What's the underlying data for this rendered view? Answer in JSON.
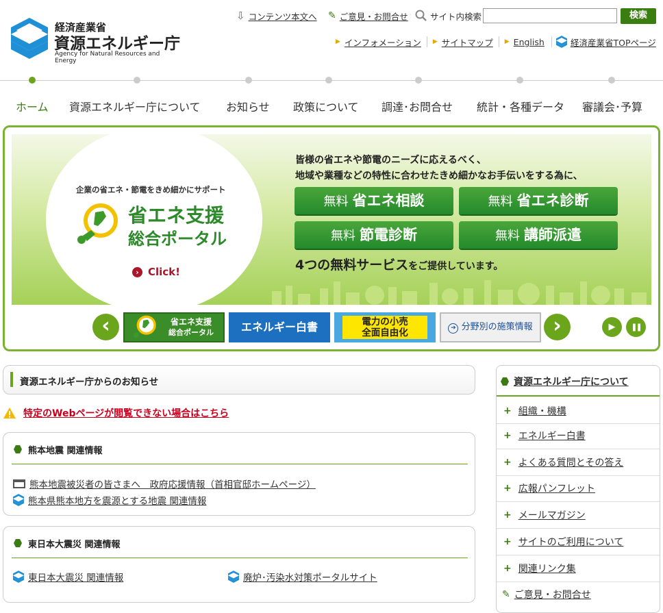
{
  "header": {
    "logo_line1": "経済産業省",
    "logo_line2": "資源エネルギー庁",
    "logo_line3": "Agency for Natural Resources and Energy",
    "skip_link": "コンテンツ本文へ",
    "feedback_link": "ご意見・お問合せ",
    "search_label": "サイト内検索",
    "search_placeholder": "",
    "search_button": "検索",
    "sub_links": [
      "インフォメーション",
      "サイトマップ",
      "English"
    ],
    "meti_top": "経済産業省TOPページ"
  },
  "nav": {
    "items": [
      "ホーム",
      "資源エネルギー庁について",
      "お知らせ",
      "政策について",
      "調達･お問合せ",
      "統計・各種データ",
      "審議会･予算"
    ],
    "active_index": 0
  },
  "banner": {
    "subtitle": "企業の省エネ・節電をきめ細かにサポート",
    "title_line1": "省エネ支援",
    "title_line2": "総合ポータル",
    "click": "Click!",
    "headline1": "皆様の省エネや節電のニーズに応えるべく、",
    "headline2": "地域や業種などの特性に合わせたきめ細かなお手伝いをする為に、",
    "buttons": [
      {
        "prefix": "無料",
        "label": "省エネ相談"
      },
      {
        "prefix": "無料",
        "label": "省エネ診断"
      },
      {
        "prefix": "無料",
        "label": "節電診断"
      },
      {
        "prefix": "無料",
        "label": "講師派遣"
      }
    ],
    "footer_big": "4つの無料サービス",
    "footer_small": "をご提供しています。"
  },
  "carousel": {
    "prev": "‹",
    "next": "›",
    "thumbs": [
      {
        "line1": "省エネ支援",
        "line2": "総合ポータル"
      },
      {
        "line1": "エネルギー白書"
      },
      {
        "line1": "電力の小売",
        "line2": "全面自由化"
      },
      {
        "line1": "分野別の施策情報"
      }
    ],
    "play": "▶",
    "pause": "❚❚"
  },
  "notices": {
    "title": "資源エネルギー庁からのお知らせ",
    "warning": "特定のWebページが閲覧できない場合はこちら",
    "kumamoto": {
      "title": "熊本地震 関連情報",
      "links": [
        "熊本地震被災者の皆さまへ　政府応援情報（首相官邸ホームページ）",
        "熊本県熊本地方を震源とする地震 関連情報"
      ]
    },
    "higashi": {
      "title": "東日本大震災 関連情報",
      "links": [
        "東日本大震災 関連情報",
        "廃炉･汚染水対策ポータルサイト"
      ]
    }
  },
  "sidebar": {
    "title": "資源エネルギー庁について",
    "items": [
      "組織・機構",
      "エネルギー白書",
      "よくある質問とその答え",
      "広報パンフレット",
      "メールマガジン",
      "サイトのご利用について",
      "関連リンク集",
      "ご意見・お問合せ"
    ]
  },
  "colors": {
    "brand_green": "#3c7a14",
    "accent_green": "#6aa51c",
    "warning_red": "#c8001e",
    "logo_blue": "#1f8fd6"
  }
}
